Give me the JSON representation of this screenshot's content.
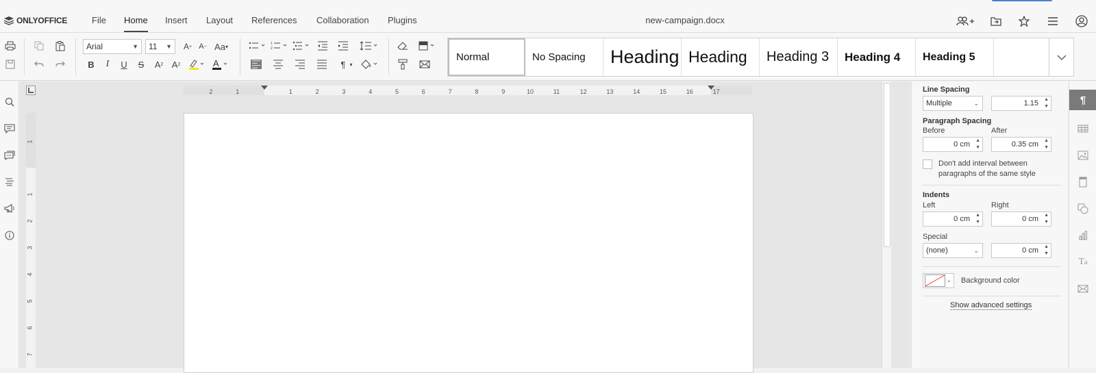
{
  "app": {
    "logo_text": "ONLYOFFICE",
    "doc_title": "new-campaign.docx"
  },
  "menu": [
    "File",
    "Home",
    "Insert",
    "Layout",
    "References",
    "Collaboration",
    "Plugins"
  ],
  "toolbar": {
    "font_name": "Arial",
    "font_size": "11"
  },
  "styles": [
    "Normal",
    "No Spacing",
    "Heading",
    "Heading",
    "Heading 3",
    "Heading 4",
    "Heading 5"
  ],
  "ruler": {
    "h_left": [
      "2",
      "1"
    ],
    "h_right": [
      "1",
      "2",
      "3",
      "4",
      "5",
      "6",
      "7",
      "8",
      "9",
      "10",
      "11",
      "12",
      "13",
      "14",
      "15",
      "16",
      "17"
    ],
    "v": [
      "1",
      "1",
      "2",
      "3",
      "4",
      "5",
      "6",
      "7"
    ]
  },
  "panel": {
    "line_spacing_title": "Line Spacing",
    "line_spacing_mode": "Multiple",
    "line_spacing_value": "1.15",
    "paragraph_spacing_title": "Paragraph Spacing",
    "before_label": "Before",
    "before_value": "0 cm",
    "after_label": "After",
    "after_value": "0.35 cm",
    "dont_add_interval": "Don't add interval between paragraphs of the same style",
    "indents_title": "Indents",
    "left_label": "Left",
    "left_value": "0 cm",
    "right_label": "Right",
    "right_value": "0 cm",
    "special_label": "Special",
    "special_mode": "(none)",
    "special_value": "0 cm",
    "background_color_label": "Background color",
    "advanced_link": "Show advanced settings"
  }
}
